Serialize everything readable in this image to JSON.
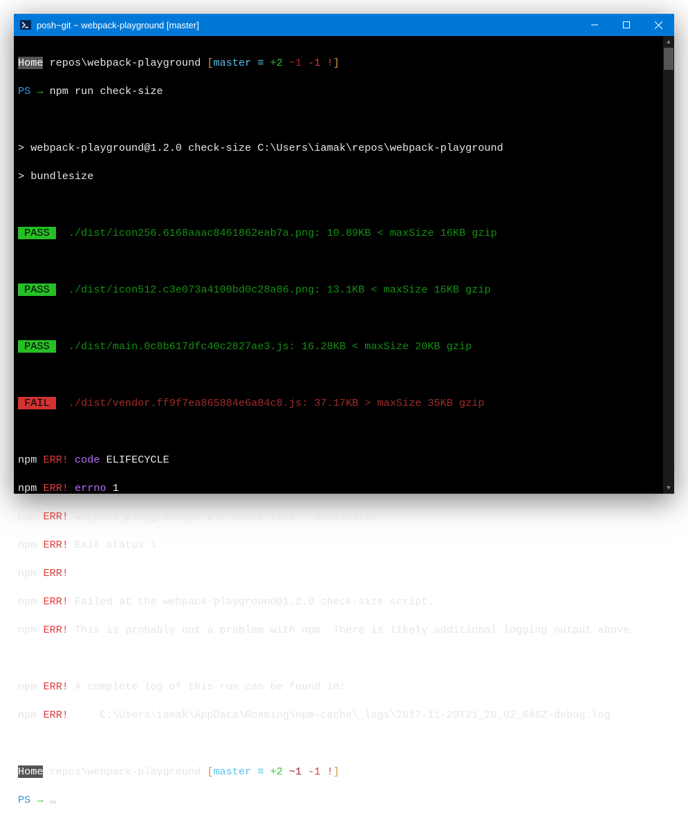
{
  "window": {
    "title": "posh~git ~ webpack-playground [master]"
  },
  "prompt1": {
    "home": "Home",
    "path": " repos\\webpack-playground ",
    "br1": "[",
    "branch": "master",
    "sep": " ≡ ",
    "ahead": "+2",
    "mid": " ~1 ",
    "behind": "-1 !",
    "br2": "]"
  },
  "ps1": {
    "ps": "PS ",
    "arrow": "→",
    "cmd": " npm run check-size"
  },
  "run1": "> webpack-playground@1.2.0 check-size C:\\Users\\iamak\\repos\\webpack-playground",
  "run2": "> bundlesize",
  "pass": " PASS ",
  "fail": " FAIL ",
  "r1": "  ./dist/icon256.6168aaac8461862eab7a.png: 10.89KB < maxSize 16KB gzip",
  "r2": "  ./dist/icon512.c3e073a4100bd0c28a86.png: 13.1KB < maxSize 16KB gzip",
  "r3": "  ./dist/main.0c8b617dfc40c2827ae3.js: 16.28KB < maxSize 20KB gzip",
  "r4": "  ./dist/vendor.ff9f7ea865884e6a84c8.js: 37.17KB > maxSize 35KB gzip",
  "npm": "npm ",
  "err": "ERR!",
  "e1a": " code",
  "e1b": " ELIFECYCLE",
  "e2a": " errno",
  "e2b": " 1",
  "e3": " webpack-playground@1.2.0 check-size: `bundlesize`",
  "e4": " Exit status 1",
  "e5": " Failed at the webpack-playground@1.2.0 check-size script.",
  "e6": " This is probably not a problem with npm. There is likely additional logging output above.",
  "e7": " A complete log of this run can be found in:",
  "e8": "     C:\\Users\\iamak\\AppData\\Roaming\\npm-cache\\_logs\\2017-11-29T21_20_02_646Z-debug.log",
  "prompt2": {
    "ps": "PS ",
    "arrow": "→ "
  }
}
